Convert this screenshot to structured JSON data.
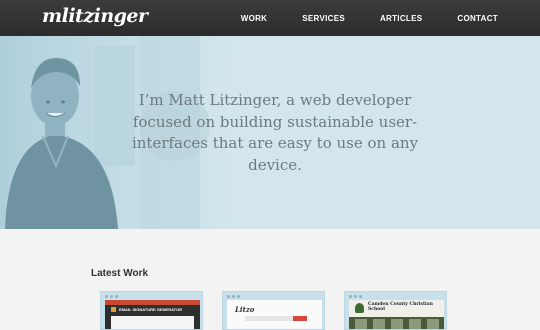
{
  "header": {
    "logo": "mlitzinger",
    "nav": [
      "WORK",
      "SERVICES",
      "ARTICLES",
      "CONTACT"
    ]
  },
  "hero": {
    "tagline": "I’m Matt Litzinger, a web developer focused on building sustainable user-interfaces that are easy to use on any device."
  },
  "latest_work": {
    "title": "Latest Work",
    "items": [
      {
        "caption": "EMAIL SIGNATURE GENERATOR"
      },
      {
        "caption": "Litzo"
      },
      {
        "caption": "Camden County Christian School"
      }
    ]
  },
  "colors": {
    "header_bg": "#2f2f2f",
    "hero_bg": "#d3e6ed",
    "hero_text": "#6b7a80",
    "page_bg": "#f3f3f3"
  }
}
